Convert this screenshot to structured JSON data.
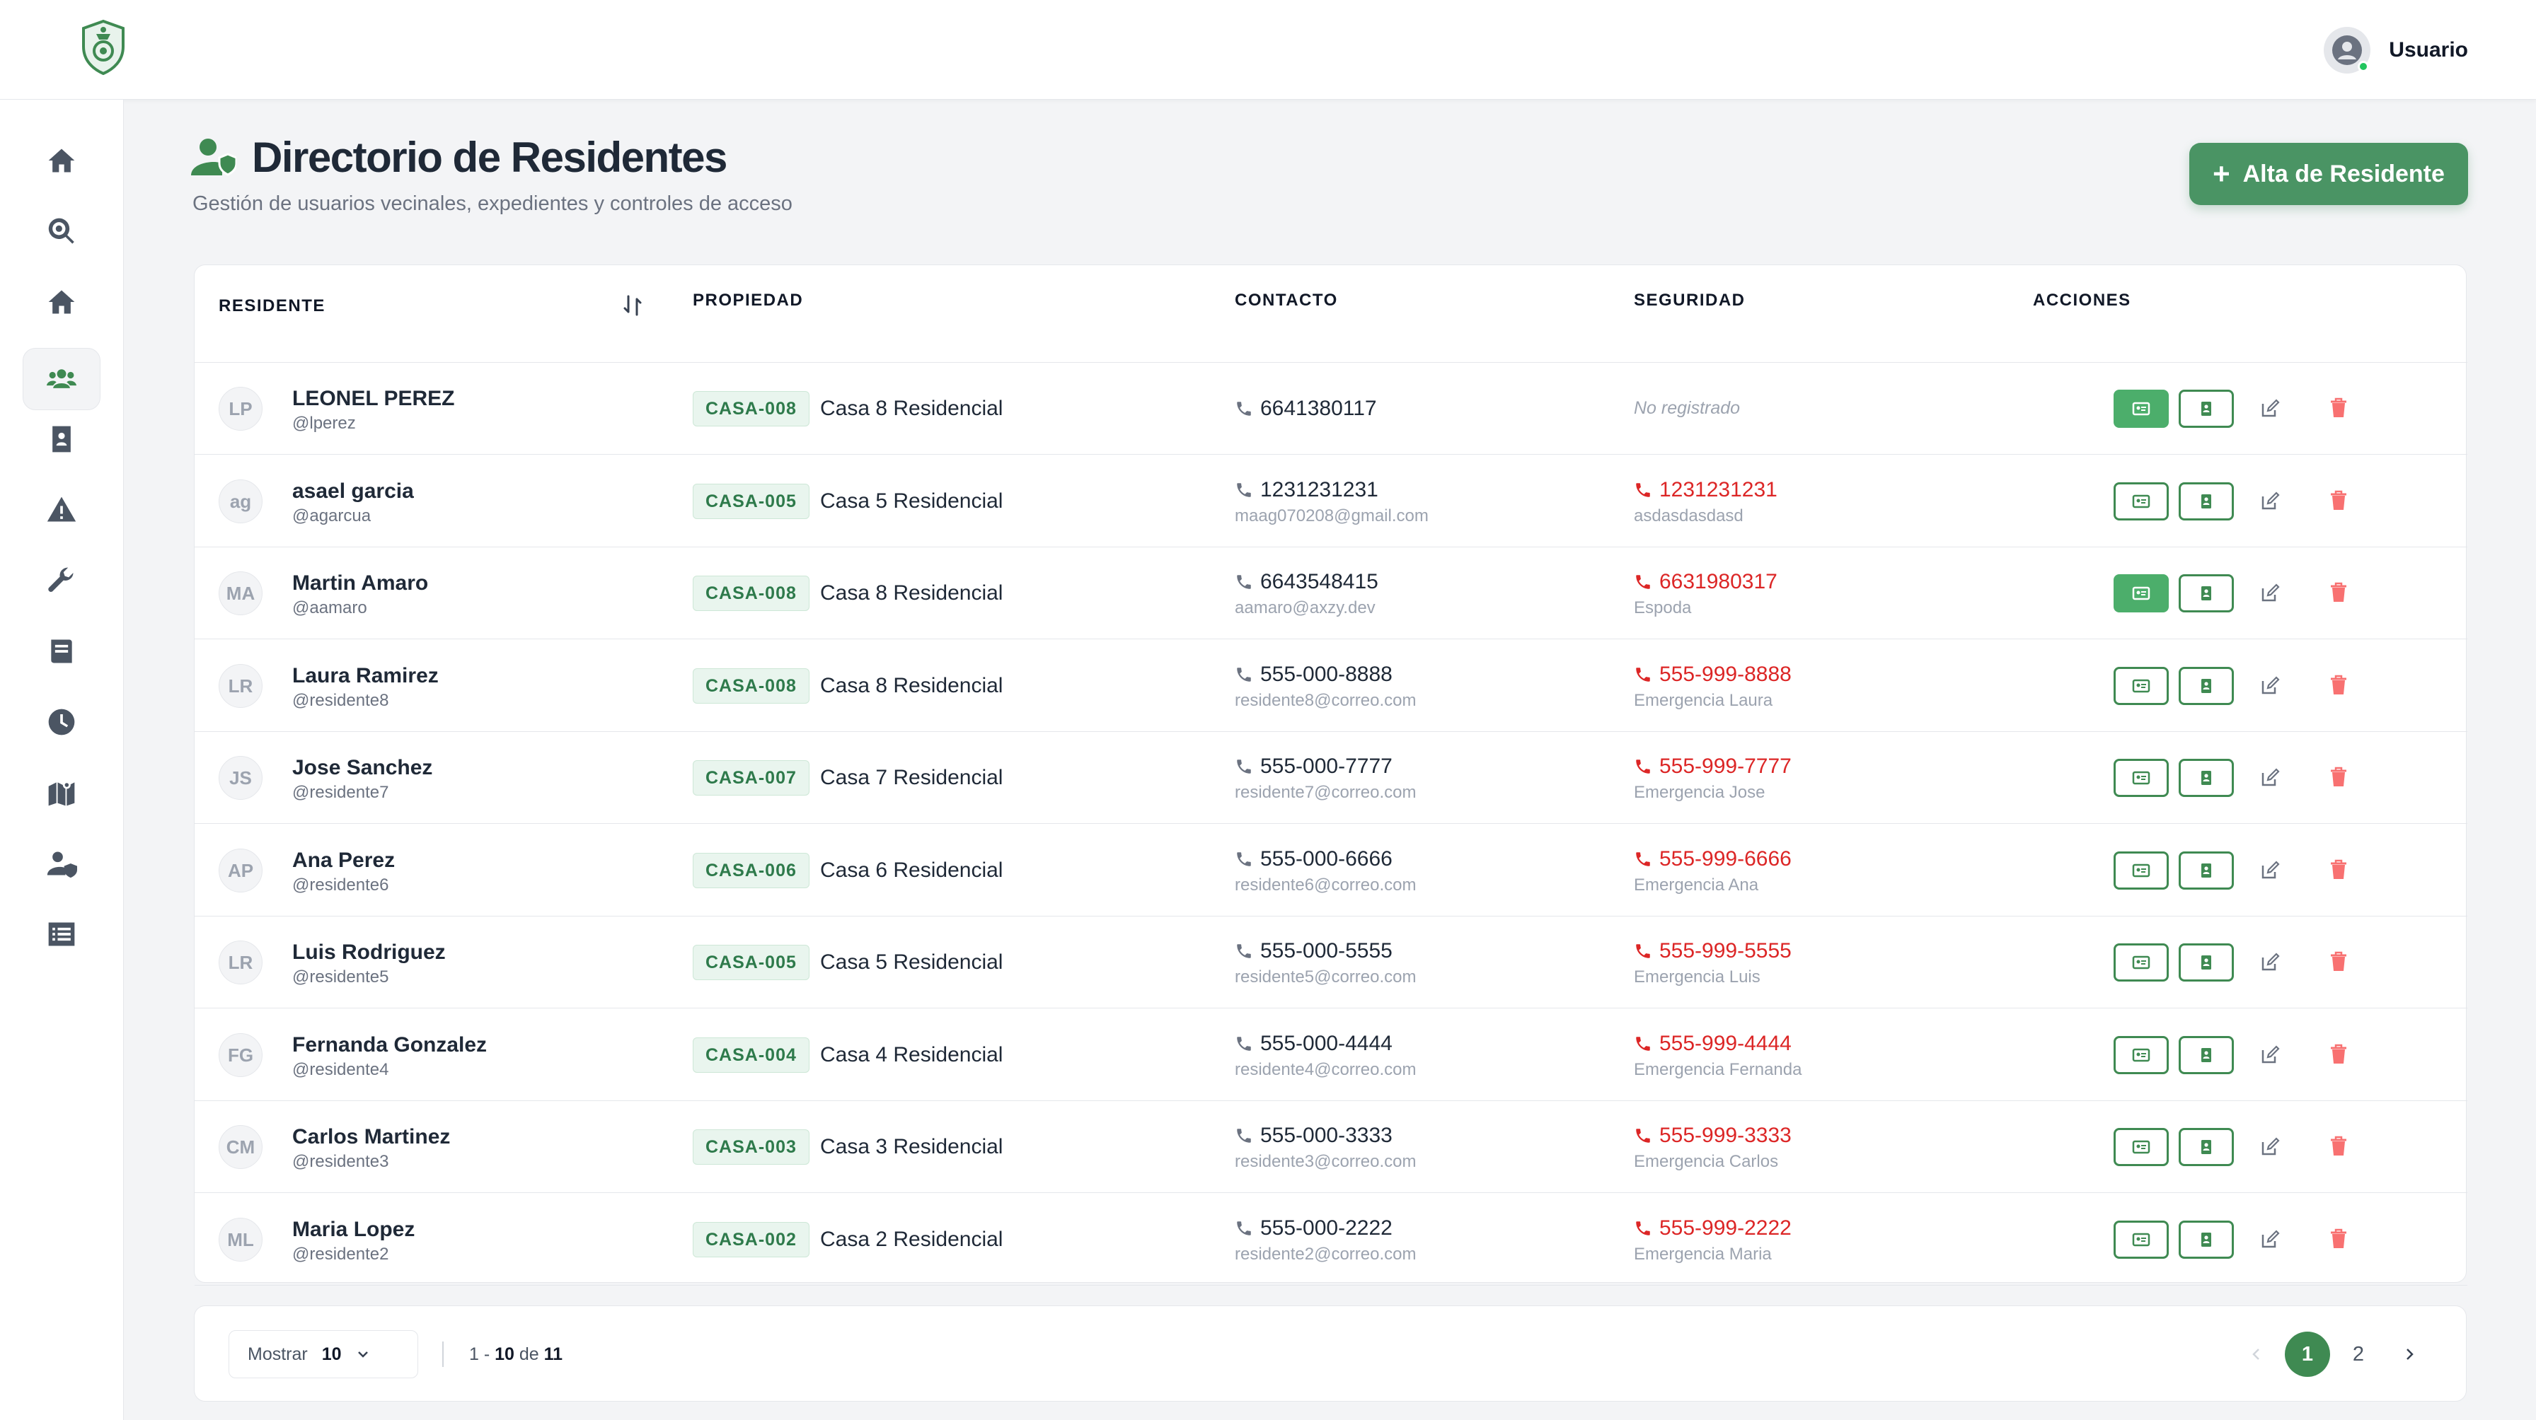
{
  "header": {
    "user_name": "Usuario"
  },
  "page": {
    "title": "Directorio de Residentes",
    "subtitle": "Gestión de usuarios vecinales, expedientes y controles de acceso",
    "add_button": "Alta de Residente"
  },
  "table": {
    "columns": [
      "RESIDENTE",
      "PROPIEDAD",
      "CONTACTO",
      "SEGURIDAD",
      "ACCIONES"
    ],
    "rows": [
      {
        "initials": "LP",
        "name": "LEONEL PEREZ",
        "username": "@lperez",
        "code": "CASA-008",
        "property": "Casa 8 Residencial",
        "phone": "6641380117",
        "email": "",
        "security_phone": "",
        "security_name": "",
        "security_missing": "No registrado",
        "card_active": true
      },
      {
        "initials": "ag",
        "name": "asael garcia",
        "username": "@agarcua",
        "code": "CASA-005",
        "property": "Casa 5 Residencial",
        "phone": "1231231231",
        "email": "maag070208@gmail.com",
        "security_phone": "1231231231",
        "security_name": "asdasdasdasd",
        "card_active": false
      },
      {
        "initials": "MA",
        "name": "Martin Amaro",
        "username": "@aamaro",
        "code": "CASA-008",
        "property": "Casa 8 Residencial",
        "phone": "6643548415",
        "email": "aamaro@axzy.dev",
        "security_phone": "6631980317",
        "security_name": "Espoda",
        "card_active": true
      },
      {
        "initials": "LR",
        "name": "Laura Ramirez",
        "username": "@residente8",
        "code": "CASA-008",
        "property": "Casa 8 Residencial",
        "phone": "555-000-8888",
        "email": "residente8@correo.com",
        "security_phone": "555-999-8888",
        "security_name": "Emergencia Laura",
        "card_active": false
      },
      {
        "initials": "JS",
        "name": "Jose Sanchez",
        "username": "@residente7",
        "code": "CASA-007",
        "property": "Casa 7 Residencial",
        "phone": "555-000-7777",
        "email": "residente7@correo.com",
        "security_phone": "555-999-7777",
        "security_name": "Emergencia Jose",
        "card_active": false
      },
      {
        "initials": "AP",
        "name": "Ana Perez",
        "username": "@residente6",
        "code": "CASA-006",
        "property": "Casa 6 Residencial",
        "phone": "555-000-6666",
        "email": "residente6@correo.com",
        "security_phone": "555-999-6666",
        "security_name": "Emergencia Ana",
        "card_active": false
      },
      {
        "initials": "LR",
        "name": "Luis Rodriguez",
        "username": "@residente5",
        "code": "CASA-005",
        "property": "Casa 5 Residencial",
        "phone": "555-000-5555",
        "email": "residente5@correo.com",
        "security_phone": "555-999-5555",
        "security_name": "Emergencia Luis",
        "card_active": false
      },
      {
        "initials": "FG",
        "name": "Fernanda Gonzalez",
        "username": "@residente4",
        "code": "CASA-004",
        "property": "Casa 4 Residencial",
        "phone": "555-000-4444",
        "email": "residente4@correo.com",
        "security_phone": "555-999-4444",
        "security_name": "Emergencia Fernanda",
        "card_active": false
      },
      {
        "initials": "CM",
        "name": "Carlos Martinez",
        "username": "@residente3",
        "code": "CASA-003",
        "property": "Casa 3 Residencial",
        "phone": "555-000-3333",
        "email": "residente3@correo.com",
        "security_phone": "555-999-3333",
        "security_name": "Emergencia Carlos",
        "card_active": false
      },
      {
        "initials": "ML",
        "name": "Maria Lopez",
        "username": "@residente2",
        "code": "CASA-002",
        "property": "Casa 2 Residencial",
        "phone": "555-000-2222",
        "email": "residente2@correo.com",
        "security_phone": "555-999-2222",
        "security_name": "Emergencia Maria",
        "card_active": false
      }
    ]
  },
  "pagination": {
    "show_label": "Mostrar",
    "page_size": "10",
    "range_start": "1",
    "range_end": "10",
    "range_of": "de",
    "total": "11",
    "pages": [
      "1",
      "2"
    ],
    "current_page": "1"
  },
  "colors": {
    "accent": "#3f8a52",
    "button": "#4a9464",
    "danger": "#dc2626"
  }
}
